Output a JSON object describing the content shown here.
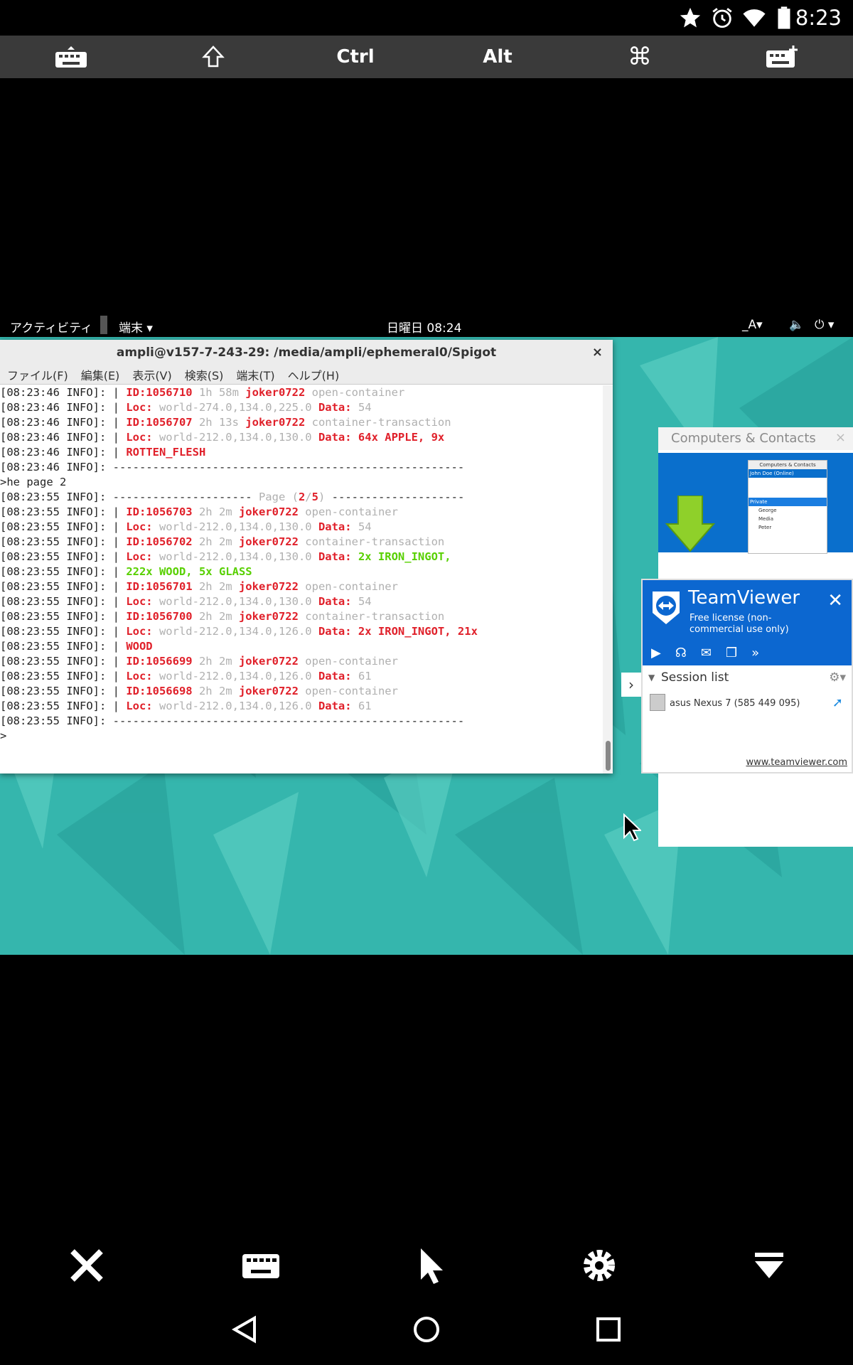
{
  "status_bar": {
    "time": "8:23",
    "icons": [
      "star-icon",
      "alarm-icon",
      "wifi-icon",
      "battery-icon"
    ]
  },
  "key_toolbar": {
    "keyboard": "keyboard-icon",
    "shift": "shift-arrow-icon",
    "ctrl": "Ctrl",
    "alt": "Alt",
    "command": "⌘",
    "extra_keyboard": "keyboard-plus-icon"
  },
  "desktop_topbar": {
    "activities": "アクティビティ",
    "app": "端末",
    "clock": "日曜日 08:24",
    "input": "_A"
  },
  "terminal": {
    "title": "ampli@v157-7-243-29: /media/ampli/ephemeral0/Spigot",
    "menu": [
      "ファイル(F)",
      "編集(E)",
      "表示(V)",
      "検索(S)",
      "端末(T)",
      "ヘルプ(H)"
    ],
    "lines": [
      [
        {
          "t": "[08:23:46 INFO]: | ",
          "c": ""
        },
        {
          "t": "ID:1056710",
          "c": "r"
        },
        {
          "t": " 1h 58m ",
          "c": "g"
        },
        {
          "t": "joker0722",
          "c": "r"
        },
        {
          "t": " open-container",
          "c": "g"
        }
      ],
      [
        {
          "t": "[08:23:46 INFO]: | ",
          "c": ""
        },
        {
          "t": "Loc:",
          "c": "r"
        },
        {
          "t": " world-274.0,134.0,225.0 ",
          "c": "g"
        },
        {
          "t": "Data:",
          "c": "r"
        },
        {
          "t": " 54",
          "c": "g"
        }
      ],
      [
        {
          "t": "[08:23:46 INFO]: | ",
          "c": ""
        },
        {
          "t": "ID:1056707",
          "c": "r"
        },
        {
          "t": " 2h 13s ",
          "c": "g"
        },
        {
          "t": "joker0722",
          "c": "r"
        },
        {
          "t": " container-transaction",
          "c": "g"
        }
      ],
      [
        {
          "t": "[08:23:46 INFO]: | ",
          "c": ""
        },
        {
          "t": "Loc:",
          "c": "r"
        },
        {
          "t": " world-212.0,134.0,130.0 ",
          "c": "g"
        },
        {
          "t": "Data: 64x APPLE, 9x",
          "c": "r"
        }
      ],
      [
        {
          "t": "[08:23:46 INFO]: | ",
          "c": ""
        },
        {
          "t": "ROTTEN_FLESH",
          "c": "r"
        }
      ],
      [
        {
          "t": "[08:23:46 INFO]: -----------------------------------------------------",
          "c": ""
        }
      ],
      [
        {
          "t": ">he page 2",
          "c": ""
        }
      ],
      [
        {
          "t": "[08:23:55 INFO]: --------------------- ",
          "c": ""
        },
        {
          "t": "Page (",
          "c": "g"
        },
        {
          "t": "2",
          "c": "r"
        },
        {
          "t": "/",
          "c": "g"
        },
        {
          "t": "5",
          "c": "r"
        },
        {
          "t": ")",
          "c": "g"
        },
        {
          "t": " --------------------",
          "c": ""
        }
      ],
      [
        {
          "t": "[08:23:55 INFO]: | ",
          "c": ""
        },
        {
          "t": "ID:1056703",
          "c": "r"
        },
        {
          "t": " 2h 2m ",
          "c": "g"
        },
        {
          "t": "joker0722",
          "c": "r"
        },
        {
          "t": " open-container",
          "c": "g"
        }
      ],
      [
        {
          "t": "[08:23:55 INFO]: | ",
          "c": ""
        },
        {
          "t": "Loc:",
          "c": "r"
        },
        {
          "t": " world-212.0,134.0,130.0 ",
          "c": "g"
        },
        {
          "t": "Data:",
          "c": "r"
        },
        {
          "t": " 54",
          "c": "g"
        }
      ],
      [
        {
          "t": "[08:23:55 INFO]: | ",
          "c": ""
        },
        {
          "t": "ID:1056702",
          "c": "r"
        },
        {
          "t": " 2h 2m ",
          "c": "g"
        },
        {
          "t": "joker0722",
          "c": "r"
        },
        {
          "t": " container-transaction",
          "c": "g"
        }
      ],
      [
        {
          "t": "[08:23:55 INFO]: | ",
          "c": ""
        },
        {
          "t": "Loc:",
          "c": "r"
        },
        {
          "t": " world-212.0,134.0,130.0 ",
          "c": "g"
        },
        {
          "t": "Data:",
          "c": "r"
        },
        {
          "t": " 2x IRON_INGOT,",
          "c": "gr"
        }
      ],
      [
        {
          "t": "[08:23:55 INFO]: | ",
          "c": ""
        },
        {
          "t": "222x WOOD, 5x GLASS",
          "c": "gr"
        }
      ],
      [
        {
          "t": "[08:23:55 INFO]: | ",
          "c": ""
        },
        {
          "t": "ID:1056701",
          "c": "r"
        },
        {
          "t": " 2h 2m ",
          "c": "g"
        },
        {
          "t": "joker0722",
          "c": "r"
        },
        {
          "t": " open-container",
          "c": "g"
        }
      ],
      [
        {
          "t": "[08:23:55 INFO]: | ",
          "c": ""
        },
        {
          "t": "Loc:",
          "c": "r"
        },
        {
          "t": " world-212.0,134.0,130.0 ",
          "c": "g"
        },
        {
          "t": "Data:",
          "c": "r"
        },
        {
          "t": " 54",
          "c": "g"
        }
      ],
      [
        {
          "t": "[08:23:55 INFO]: | ",
          "c": ""
        },
        {
          "t": "ID:1056700",
          "c": "r"
        },
        {
          "t": " 2h 2m ",
          "c": "g"
        },
        {
          "t": "joker0722",
          "c": "r"
        },
        {
          "t": " container-transaction",
          "c": "g"
        }
      ],
      [
        {
          "t": "[08:23:55 INFO]: | ",
          "c": ""
        },
        {
          "t": "Loc:",
          "c": "r"
        },
        {
          "t": " world-212.0,134.0,126.0 ",
          "c": "g"
        },
        {
          "t": "Data: 2x IRON_INGOT, 21x",
          "c": "r"
        }
      ],
      [
        {
          "t": "[08:23:55 INFO]: | ",
          "c": ""
        },
        {
          "t": "WOOD",
          "c": "r"
        }
      ],
      [
        {
          "t": "[08:23:55 INFO]: | ",
          "c": ""
        },
        {
          "t": "ID:1056699",
          "c": "r"
        },
        {
          "t": " 2h 2m ",
          "c": "g"
        },
        {
          "t": "joker0722",
          "c": "r"
        },
        {
          "t": " open-container",
          "c": "g"
        }
      ],
      [
        {
          "t": "[08:23:55 INFO]: | ",
          "c": ""
        },
        {
          "t": "Loc:",
          "c": "r"
        },
        {
          "t": " world-212.0,134.0,126.0 ",
          "c": "g"
        },
        {
          "t": "Data:",
          "c": "r"
        },
        {
          "t": " 61",
          "c": "g"
        }
      ],
      [
        {
          "t": "[08:23:55 INFO]: | ",
          "c": ""
        },
        {
          "t": "ID:1056698",
          "c": "r"
        },
        {
          "t": " 2h 2m ",
          "c": "g"
        },
        {
          "t": "joker0722",
          "c": "r"
        },
        {
          "t": " open-container",
          "c": "g"
        }
      ],
      [
        {
          "t": "[08:23:55 INFO]: | ",
          "c": ""
        },
        {
          "t": "Loc:",
          "c": "r"
        },
        {
          "t": " world-212.0,134.0,126.0 ",
          "c": "g"
        },
        {
          "t": "Data:",
          "c": "r"
        },
        {
          "t": " 61",
          "c": "g"
        }
      ],
      [
        {
          "t": "[08:23:55 INFO]: -----------------------------------------------------",
          "c": ""
        }
      ],
      [
        {
          "t": ">",
          "c": ""
        }
      ]
    ]
  },
  "computers_contacts": {
    "title": "Computers & Contacts",
    "thumb_header": "Computers & Contacts",
    "thumb_user": "John Doe (Online)",
    "thumb_group": "Private",
    "thumb_items": [
      "George",
      "Media",
      "Peter"
    ]
  },
  "teamviewer": {
    "title": "TeamViewer",
    "subtitle": "Free license (non-commercial use only)",
    "session_list": "Session list",
    "device": "asus Nexus 7 (585 449 095)",
    "link": "www.teamviewer.com"
  },
  "colors": {
    "teamviewer_blue": "#0c67d0",
    "wallpaper": "#35b6ad",
    "log_red": "#e0202a",
    "log_green": "#58d000"
  }
}
